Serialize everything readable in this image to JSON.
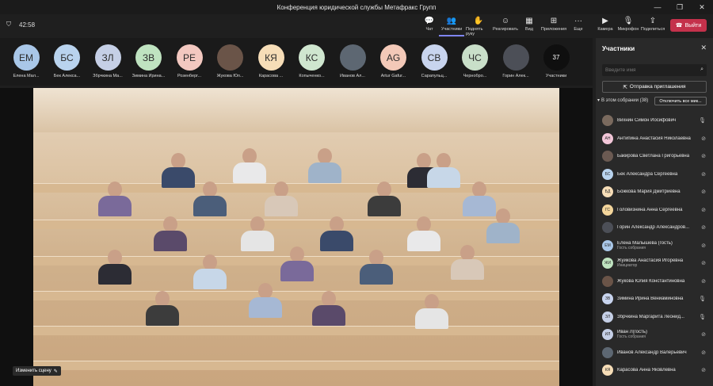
{
  "window": {
    "title": "Конференция юридической службы Метафракс Групп"
  },
  "toolbar": {
    "timer": "42:58",
    "buttons": [
      {
        "label": "Чат",
        "icon": "💬"
      },
      {
        "label": "Участники",
        "icon": "👥"
      },
      {
        "label": "Поднять руку",
        "icon": "✋"
      },
      {
        "label": "Реагировать",
        "icon": "☺"
      },
      {
        "label": "Вид",
        "icon": "▦"
      },
      {
        "label": "Приложения",
        "icon": "⊞"
      },
      {
        "label": "Еще",
        "icon": "···"
      },
      {
        "label": "Камера",
        "icon": "▶"
      },
      {
        "label": "Микрофон",
        "icon": "🎙"
      },
      {
        "label": "Поделиться",
        "icon": "⇪"
      }
    ],
    "leave_label": "Выйти"
  },
  "strip": {
    "participants": [
      {
        "initials": "ЕМ",
        "name": "Елена Мал...",
        "color": "#a9c7e8"
      },
      {
        "initials": "БС",
        "name": "Бек Алекса...",
        "color": "#b9d3ee"
      },
      {
        "initials": "ЗЛ",
        "name": "Збрчкина Ма...",
        "color": "#c5cfe6"
      },
      {
        "initials": "ЗВ",
        "name": "Зимина Ирина...",
        "color": "#bfe3c0"
      },
      {
        "initials": "РЕ",
        "name": "Розенберг...",
        "color": "#f3c8c0"
      },
      {
        "initials": "",
        "name": "Жукова Юл...",
        "color": "#6a5448"
      },
      {
        "initials": "КЯ",
        "name": "Карасова ...",
        "color": "#f6ddb7"
      },
      {
        "initials": "КС",
        "name": "Копыченко...",
        "color": "#cfe6cf"
      },
      {
        "initials": "",
        "name": "Иванов Ал...",
        "color": "#5d6772"
      },
      {
        "initials": "AG",
        "name": "Artur Gafur...",
        "color": "#f3c9b8"
      },
      {
        "initials": "СВ",
        "name": "Сарапульц...",
        "color": "#c8d4ee"
      },
      {
        "initials": "ЧС",
        "name": "Чернобро...",
        "color": "#c9dfc9"
      },
      {
        "initials": "",
        "name": "Горин Алек...",
        "color": "#4c4f57"
      }
    ],
    "more_count": "37",
    "more_label": "Участники"
  },
  "stage": {
    "change_scene_label": "Изменить сцену"
  },
  "panel": {
    "title": "Участники",
    "search_placeholder": "Введите имя",
    "invite_label": "Отправка приглашения",
    "section_label": "В этом собрании (38)",
    "mute_all_label": "Отключить все мик...",
    "people": [
      {
        "initials": "",
        "name": "Вихнин Симон Иосифович",
        "sub": "",
        "color": "#7a6a5e",
        "mic": "on"
      },
      {
        "initials": "АН",
        "name": "Антипина Анастасия Николаевна",
        "sub": "",
        "color": "#f2c6d8",
        "mic": "off"
      },
      {
        "initials": "",
        "name": "Бакирова Светлана Григорьевна",
        "sub": "",
        "color": "#6b5a52",
        "mic": "off"
      },
      {
        "initials": "БС",
        "name": "Бек Александра Сергеевна",
        "sub": "",
        "color": "#b9d3ee",
        "mic": "off"
      },
      {
        "initials": "БД",
        "name": "Божкова Мария Дмитриевна",
        "sub": "",
        "color": "#f6ddb7",
        "mic": "off"
      },
      {
        "initials": "ГС",
        "name": "Головизнина Анна Сергеевна",
        "sub": "",
        "color": "#f3d59b",
        "mic": "off"
      },
      {
        "initials": "",
        "name": "Горин Александр Александров...",
        "sub": "",
        "color": "#4c4f57",
        "mic": "off"
      },
      {
        "initials": "ЕМ",
        "name": "Елена Малышева (гость)",
        "sub": "Гость собрания",
        "color": "#a9c7e8",
        "mic": "off"
      },
      {
        "initials": "ЖИ",
        "name": "Жуйкова Анастасия Игоревна",
        "sub": "Инициатор",
        "color": "#bfe3c0",
        "mic": "off"
      },
      {
        "initials": "",
        "name": "Жукова Юлия Константиновна",
        "sub": "",
        "color": "#6a5448",
        "mic": "off"
      },
      {
        "initials": "ЗВ",
        "name": "Зимина Ирина Вениаминовна",
        "sub": "",
        "color": "#c8d4ee",
        "mic": "on"
      },
      {
        "initials": "ЗЛ",
        "name": "Збрчкина Маргарита Леонид...",
        "sub": "",
        "color": "#c5cfe6",
        "mic": "on"
      },
      {
        "initials": "ИЛ",
        "name": "Иван Л(гость)",
        "sub": "Гость собрания",
        "color": "#c5cfe6",
        "mic": "off"
      },
      {
        "initials": "",
        "name": "Иванов Александр Валерьевич",
        "sub": "",
        "color": "#5d6772",
        "mic": "off"
      },
      {
        "initials": "КЯ",
        "name": "Карасова Анна Яковлевна",
        "sub": "",
        "color": "#f6ddb7",
        "mic": "off"
      }
    ]
  },
  "colors": {
    "accent": "#7f85f5",
    "leave": "#c4314b",
    "panel_bg": "#292929"
  }
}
